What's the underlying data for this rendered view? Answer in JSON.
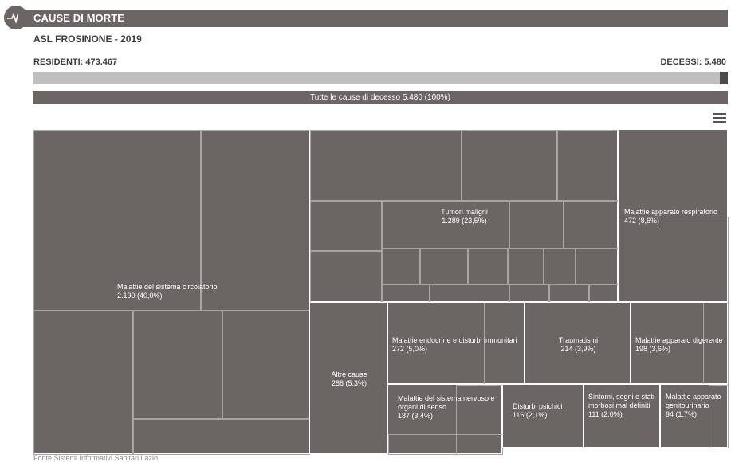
{
  "header": {
    "title": "CAUSE DI MORTE"
  },
  "subtitle": "ASL FROSINONE - 2019",
  "summary": {
    "residents": "RESIDENTI: 473.467",
    "deaths": "DECESSI: 5.480",
    "deaths_fraction": 0.012
  },
  "total_bar": "Tutte le cause di decesso  5.480 (100%)",
  "footer": "Fonte Sistemi Informativi Sanitari Lazio",
  "colors": {
    "tile": "#6b6563",
    "track": "#bfbfbf",
    "fill": "#4e4a49"
  },
  "icons": {
    "header": "heartbeat-icon",
    "menu": "hamburger-menu-icon"
  },
  "chart_data": {
    "type": "treemap",
    "items": [
      {
        "name": "Malattie del sistema circolatorio",
        "label": "2.190 (40,0%)",
        "value": 2190,
        "percent": 40.0
      },
      {
        "name": "Tumori maligni",
        "label": "1.289 (23,5%)",
        "value": 1289,
        "percent": 23.5
      },
      {
        "name": "Malattie apparato respiratorio",
        "label": "472 (8,6%)",
        "value": 472,
        "percent": 8.6
      },
      {
        "name": "Altre cause",
        "label": "288 (5,3%)",
        "value": 288,
        "percent": 5.3
      },
      {
        "name": "Malattie endocrine e disturbi immunitari",
        "label": "272 (5,0%)",
        "value": 272,
        "percent": 5.0
      },
      {
        "name": "Traumatismi",
        "label": "214 (3,9%)",
        "value": 214,
        "percent": 3.9
      },
      {
        "name": "Malattie apparato digerente",
        "label": "198 (3,6%)",
        "value": 198,
        "percent": 3.6
      },
      {
        "name": "Malattie del sistema nervoso e organi di senso",
        "label": "187 (3,4%)",
        "value": 187,
        "percent": 3.4
      },
      {
        "name": "Disturbi psichici",
        "label": "116 (2,1%)",
        "value": 116,
        "percent": 2.1
      },
      {
        "name": "Sintomi, segni e stati morbosi mal definiti",
        "label": "111 (2,0%)",
        "value": 111,
        "percent": 2.0
      },
      {
        "name": "Malattie apparato genitourinario",
        "label": "94 (1,7%)",
        "value": 94,
        "percent": 1.7
      }
    ]
  }
}
